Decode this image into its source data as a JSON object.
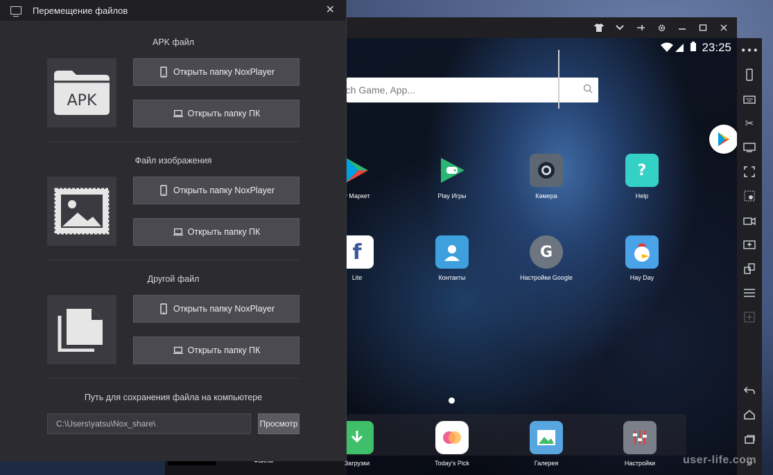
{
  "dialog": {
    "title": "Перемещение файлов",
    "sections": [
      {
        "label": "APK файл",
        "icon_text": "APK",
        "btn_nox": "Открыть папку NoxPlayer",
        "btn_pc": "Открыть папку ПК"
      },
      {
        "label": "Файл изображения",
        "btn_nox": "Открыть папку NoxPlayer",
        "btn_pc": "Открыть папку ПК"
      },
      {
        "label": "Другой файл",
        "btn_nox": "Открыть папку NoxPlayer",
        "btn_pc": "Открыть папку ПК"
      }
    ],
    "save_path_label": "Путь для сохранения файла на компьютере",
    "save_path_value": "C:\\Users\\yatsu\\Nox_share\\",
    "browse_label": "Просмотр"
  },
  "android": {
    "time": "23:25",
    "search_placeholder": "rch Game, App...",
    "apps_row1": [
      "y Маркет",
      "Play Игры",
      "Камера",
      "Help"
    ],
    "apps_row2": [
      "Lite",
      "Контакты",
      "Настройки Google",
      "Hay Day"
    ],
    "dock": [
      "Загрузки",
      "Today's Pick",
      "Галерея",
      "Настройки"
    ],
    "bottom_tab": "Файлы"
  },
  "watermark": "user-life.com",
  "colors": {
    "dialog_bg": "#2b2b30",
    "button_bg": "#4a4a50",
    "titlebar_bg": "#1f1f24"
  }
}
